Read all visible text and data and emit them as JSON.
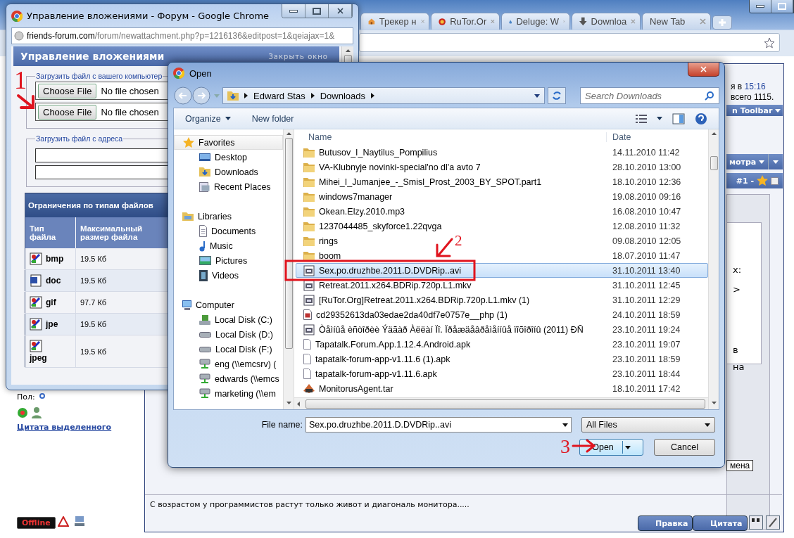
{
  "browser": {
    "tabs": [
      {
        "label": "Трекер н",
        "selected": false
      },
      {
        "label": "RuTor.Or",
        "selected": false
      },
      {
        "label": "Deluge: W",
        "selected": false
      },
      {
        "label": "Downloa",
        "selected": false
      },
      {
        "label": "New Tab",
        "selected": false
      }
    ]
  },
  "forum": {
    "visit_prefix": "я в",
    "visit_time": "15:16",
    "total": "всего 1115.",
    "toolbar_bar": "n Toolbar",
    "view_bar": "мотра",
    "post_number": "#1 -",
    "post_checked": false,
    "editor_fragments": [
      "х:",
      ">",
      "в",
      "на"
    ],
    "cancel_button": "мена",
    "gender_label": "Пол:",
    "quote_link": "Цитата выделенного",
    "status_badge": "Offline",
    "signature": "С возрастом у программистов растут только живот и диагональ монитора.....",
    "post_buttons": [
      "Правка",
      "Цитата"
    ]
  },
  "popup": {
    "title": "Управление вложениями - Форум - Google Chrome",
    "url_host": "friends-forum.com",
    "url_path": "/forum/newattachment.php?p=1216136&editpost=1&qeiajax=1&",
    "header": "Управление вложениями",
    "close_link": "Закрыть окно",
    "upload_local": {
      "legend": "Загрузить файл с вашего компьютер",
      "inputs": [
        {
          "button": "Choose File",
          "status": "No file chosen"
        },
        {
          "button": "Choose File",
          "status": "No file chosen"
        }
      ]
    },
    "upload_url": {
      "legend": "Загрузить файл с адреса"
    },
    "limits": {
      "title": "Ограничения по типам файлов",
      "columns": [
        "Тип файла",
        "Максимальный размер файла"
      ],
      "rows": [
        {
          "type": "bmp",
          "size": "19.5 Кб",
          "kind": "image"
        },
        {
          "type": "doc",
          "size": "19.5 Кб",
          "kind": "word"
        },
        {
          "type": "gif",
          "size": "97.7 Кб",
          "kind": "image"
        },
        {
          "type": "jpe",
          "size": "19.5 Кб",
          "kind": "image"
        },
        {
          "type": "jpeg",
          "size": "19.5 Кб",
          "kind": "image"
        }
      ]
    }
  },
  "dialog": {
    "title": "Open",
    "breadcrumb": [
      "Edward Stas",
      "Downloads"
    ],
    "search": {
      "placeholder": "Search Downloads"
    },
    "toolbar": [
      "Organize",
      "New folder"
    ],
    "nav": [
      {
        "label": "Favorites",
        "children": [
          {
            "label": "Desktop"
          },
          {
            "label": "Downloads"
          },
          {
            "label": "Recent Places"
          }
        ]
      },
      {
        "label": "Libraries",
        "children": [
          {
            "label": "Documents"
          },
          {
            "label": "Music"
          },
          {
            "label": "Pictures"
          },
          {
            "label": "Videos"
          }
        ]
      },
      {
        "label": "Computer",
        "children": [
          {
            "label": "Local Disk (C:)"
          },
          {
            "label": "Local Disk (D:)"
          },
          {
            "label": "Local Disk (F:)"
          },
          {
            "label": "eng (\\\\emcsrv) ("
          },
          {
            "label": "edwards (\\\\emcs"
          },
          {
            "label": "marketing (\\\\em"
          }
        ]
      }
    ],
    "columns": [
      "Name",
      "Date"
    ],
    "files": [
      {
        "name": "Butusov_I_Naytilus_Pompilius",
        "date": "14.11.2010 11:42",
        "kind": "folder",
        "selected": false
      },
      {
        "name": "VA-Klubnyje novinki-special'no dl'a avto 7",
        "date": "28.10.2010 13:00",
        "kind": "folder",
        "selected": false
      },
      {
        "name": "Mihei_I_Jumanjee_-_Smisl_Prost_2003_BY_SPOT.part1",
        "date": "18.10.2010 12:36",
        "kind": "folder",
        "selected": false
      },
      {
        "name": "windows7manager",
        "date": "19.08.2010 09:16",
        "kind": "folder",
        "selected": false
      },
      {
        "name": "Okean.Elzy.2010.mp3",
        "date": "16.08.2010 10:47",
        "kind": "folder",
        "selected": false
      },
      {
        "name": "1237044485_skyforce1.22qvga",
        "date": "12.08.2010 11:32",
        "kind": "folder",
        "selected": false
      },
      {
        "name": "rings",
        "date": "09.08.2010 12:05",
        "kind": "folder",
        "selected": false
      },
      {
        "name": "boom",
        "date": "18.07.2010 11:47",
        "kind": "folder",
        "selected": false
      },
      {
        "name": "Sex.po.druzhbe.2011.D.DVDRip..avi",
        "date": "31.10.2011 13:40",
        "kind": "video",
        "selected": true
      },
      {
        "name": "Retreat.2011.x264.BDRip.720p.L1.mkv",
        "date": "31.10.2011 12:45",
        "kind": "video",
        "selected": false
      },
      {
        "name": "[RuTor.Org]Retreat.2011.x264.BDRip.720p.L1.mkv (1)",
        "date": "31.10.2011 12:29",
        "kind": "video",
        "selected": false
      },
      {
        "name": "cd29352613da03edae2da40df7e0757e__php (1)",
        "date": "24.10.2011 18:59",
        "kind": "script",
        "selected": false
      },
      {
        "name": "Òåìíûå èñòîðèè Ýäãàð Àëëàí Ïî. Ïðåæäåâðåìåííûå ïîõîðîíû (2011)  ÐÑ",
        "date": "23.10.2011 19:24",
        "kind": "video",
        "selected": false
      },
      {
        "name": "Tapatalk.Forum.App.1.12.4.Android.apk",
        "date": "23.10.2011 19:07",
        "kind": "file",
        "selected": false
      },
      {
        "name": "tapatalk-forum-app-v1.11.6 (1).apk",
        "date": "23.10.2011 18:59",
        "kind": "file",
        "selected": false
      },
      {
        "name": "tapatalk-forum-app-v1.11.6.apk",
        "date": "23.10.2011 18:44",
        "kind": "file",
        "selected": false
      },
      {
        "name": "MonitorusAgent.tar",
        "date": "18.10.2011 17:42",
        "kind": "archive",
        "selected": false
      }
    ],
    "file_name_label": "File name:",
    "file_name": "Sex.po.druzhbe.2011.D.DVDRip..avi",
    "filter": "All Files",
    "buttons": [
      "Open",
      "Cancel"
    ]
  },
  "annotations": [
    {
      "label": "1"
    },
    {
      "label": "2"
    },
    {
      "label": "3"
    }
  ]
}
